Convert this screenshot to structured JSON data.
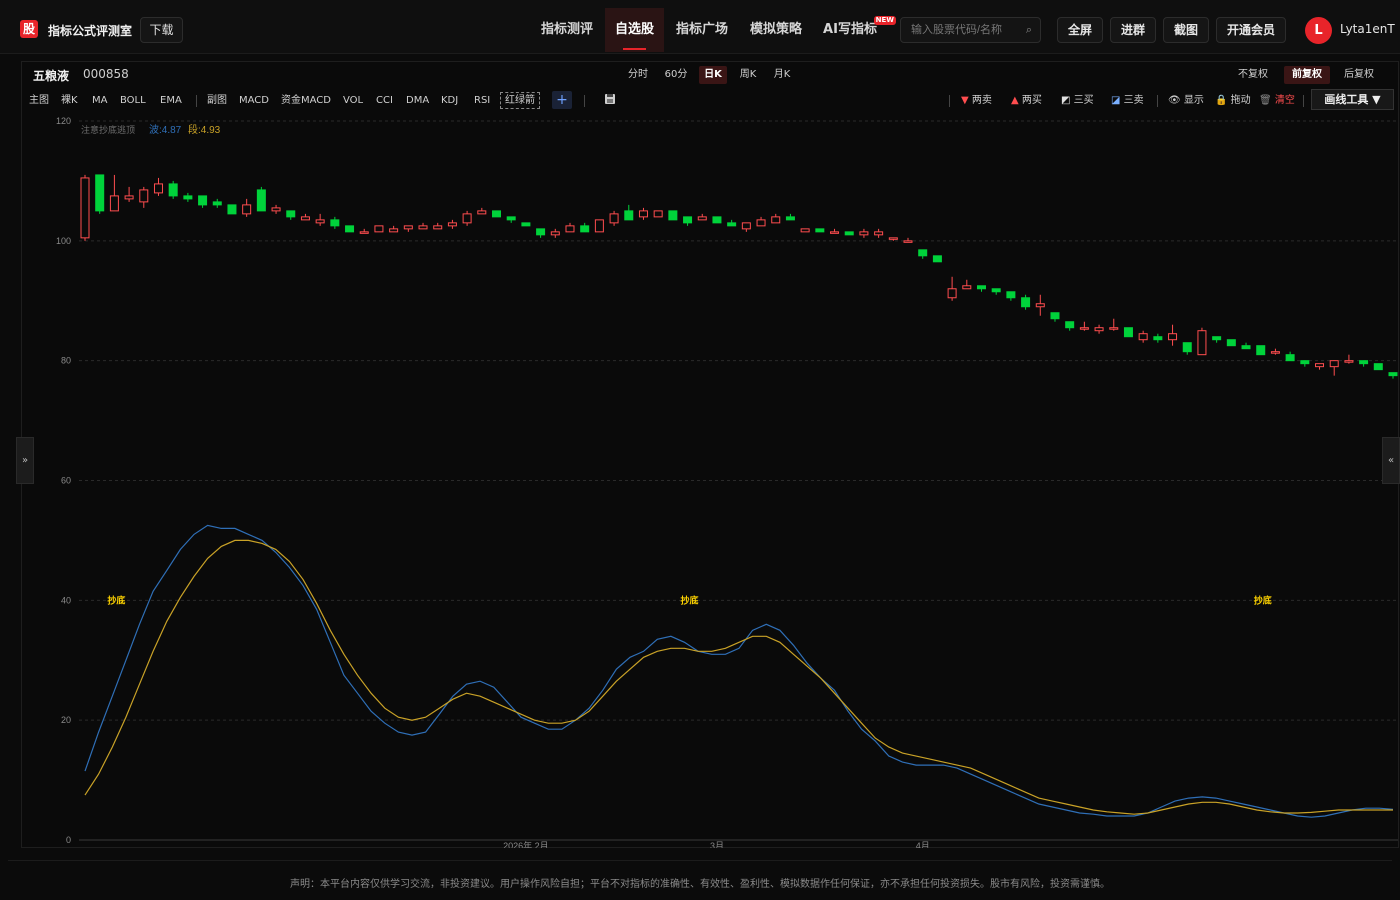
{
  "header": {
    "logo_char": "股",
    "logo_text": "指标公式评测室",
    "download_label": "下载",
    "nav": [
      "指标测评",
      "自选股",
      "指标广场",
      "模拟策略",
      "AI写指标"
    ],
    "new_badge": "NEW",
    "search_placeholder": "输入股票代码/名称",
    "fullscreen_label": "全屏",
    "join_group_label": "进群",
    "screenshot_label": "截图",
    "vip_label": "开通会员",
    "avatar_letter": "L",
    "username": "Lyta1enT"
  },
  "stock": {
    "name": "五粮液",
    "code": "000858"
  },
  "periods": [
    "分时",
    "60分",
    "日K",
    "周K",
    "月K"
  ],
  "active_period": "日K",
  "adjustments": [
    "不复权",
    "前复权",
    "后复权"
  ],
  "active_adjustment": "前复权",
  "indicators": {
    "main_group": [
      "主图",
      "裸K",
      "MA",
      "BOLL",
      "EMA"
    ],
    "sub_group": [
      "副图",
      "MACD",
      "资金MACD",
      "VOL",
      "CCI",
      "DMA",
      "KDJ",
      "RSI",
      "红绿箭"
    ],
    "plus_label": "+"
  },
  "draw_bar": {
    "two_sell": "两卖",
    "two_buy": "两买",
    "three_buy": "三买",
    "three_sell": "三卖",
    "show": "显示",
    "drag": "拖动",
    "clear": "清空",
    "tool_button": "画线工具 ▼"
  },
  "legend": {
    "label": "注意抄底逃顶",
    "wave_text": "波:4.87",
    "segment_text": "段:4.93"
  },
  "signals": {
    "label": "抄底"
  },
  "colors": {
    "up": "#ff4d4f",
    "down": "#00d33b",
    "wave": "#2f6fb7",
    "segment": "#c9a227",
    "signal": "#ffd400",
    "accent": "#e8242a"
  },
  "chart_data": {
    "type": "candlestick+line",
    "y_axis": {
      "range": [
        0,
        120
      ],
      "ticks": [
        0,
        20,
        40,
        60,
        80,
        100,
        120
      ]
    },
    "x_labels": [
      "2026年 2月",
      "3月",
      "4月"
    ],
    "candles": [
      {
        "o": 100.5,
        "c": 110.5,
        "h": 111,
        "l": 100
      },
      {
        "o": 111,
        "c": 105,
        "h": 111,
        "l": 104.5
      },
      {
        "o": 105,
        "c": 107.5,
        "h": 111,
        "l": 105
      },
      {
        "o": 107,
        "c": 107.5,
        "h": 109,
        "l": 106.5
      },
      {
        "o": 106.5,
        "c": 108.5,
        "h": 109,
        "l": 105.5
      },
      {
        "o": 108,
        "c": 109.5,
        "h": 110.5,
        "l": 107.5
      },
      {
        "o": 109.5,
        "c": 107.5,
        "h": 110,
        "l": 107
      },
      {
        "o": 107.5,
        "c": 107,
        "h": 108,
        "l": 106.5
      },
      {
        "o": 107.5,
        "c": 106,
        "h": 107.5,
        "l": 105.5
      },
      {
        "o": 106.5,
        "c": 106,
        "h": 107,
        "l": 105.5
      },
      {
        "o": 106,
        "c": 104.5,
        "h": 106,
        "l": 104.5
      },
      {
        "o": 104.5,
        "c": 106,
        "h": 107,
        "l": 104
      },
      {
        "o": 108.5,
        "c": 105,
        "h": 109,
        "l": 105
      },
      {
        "o": 105,
        "c": 105.5,
        "h": 106,
        "l": 104.5
      },
      {
        "o": 105,
        "c": 104,
        "h": 105,
        "l": 103.5
      },
      {
        "o": 103.5,
        "c": 104,
        "h": 104.5,
        "l": 103.5
      },
      {
        "o": 103,
        "c": 103.5,
        "h": 104.5,
        "l": 102.5
      },
      {
        "o": 103.5,
        "c": 102.5,
        "h": 104,
        "l": 102
      },
      {
        "o": 102.5,
        "c": 101.5,
        "h": 102.5,
        "l": 101.5
      },
      {
        "o": 101.5,
        "c": 101.5,
        "h": 102,
        "l": 101.5
      },
      {
        "o": 101.5,
        "c": 102.5,
        "h": 102.5,
        "l": 101.5
      },
      {
        "o": 101.5,
        "c": 102,
        "h": 102.5,
        "l": 101.5
      },
      {
        "o": 102,
        "c": 102.5,
        "h": 102.5,
        "l": 101.5
      },
      {
        "o": 102,
        "c": 102.5,
        "h": 103,
        "l": 102
      },
      {
        "o": 102,
        "c": 102.5,
        "h": 103,
        "l": 102
      },
      {
        "o": 102.5,
        "c": 103,
        "h": 103.5,
        "l": 102
      },
      {
        "o": 103,
        "c": 104.5,
        "h": 105,
        "l": 102.5
      },
      {
        "o": 104.5,
        "c": 105,
        "h": 105.5,
        "l": 104.5
      },
      {
        "o": 105,
        "c": 104,
        "h": 105,
        "l": 104
      },
      {
        "o": 104,
        "c": 103.5,
        "h": 104,
        "l": 103
      },
      {
        "o": 103,
        "c": 102.5,
        "h": 103,
        "l": 102.5
      },
      {
        "o": 102,
        "c": 101,
        "h": 102,
        "l": 100.5
      },
      {
        "o": 101,
        "c": 101.5,
        "h": 102,
        "l": 100.5
      },
      {
        "o": 101.5,
        "c": 102.5,
        "h": 103,
        "l": 101.5
      },
      {
        "o": 102.5,
        "c": 101.5,
        "h": 103,
        "l": 101.5
      },
      {
        "o": 101.5,
        "c": 103.5,
        "h": 103.5,
        "l": 101.5
      },
      {
        "o": 103,
        "c": 104.5,
        "h": 105,
        "l": 102.5
      },
      {
        "o": 105,
        "c": 103.5,
        "h": 106,
        "l": 103.5
      },
      {
        "o": 104,
        "c": 105,
        "h": 105.5,
        "l": 103.5
      },
      {
        "o": 104,
        "c": 105,
        "h": 105,
        "l": 104
      },
      {
        "o": 105,
        "c": 103.5,
        "h": 105,
        "l": 103.5
      },
      {
        "o": 104,
        "c": 103,
        "h": 104,
        "l": 102.5
      },
      {
        "o": 103.5,
        "c": 104,
        "h": 104.5,
        "l": 103.5
      },
      {
        "o": 104,
        "c": 103,
        "h": 104,
        "l": 103
      },
      {
        "o": 103,
        "c": 102.5,
        "h": 103.5,
        "l": 102.5
      },
      {
        "o": 102,
        "c": 103,
        "h": 103,
        "l": 101.5
      },
      {
        "o": 102.5,
        "c": 103.5,
        "h": 104,
        "l": 102.5
      },
      {
        "o": 103,
        "c": 104,
        "h": 104.5,
        "l": 103
      },
      {
        "o": 104,
        "c": 103.5,
        "h": 104.5,
        "l": 103.5
      },
      {
        "o": 101.5,
        "c": 102,
        "h": 102,
        "l": 101.5
      },
      {
        "o": 102,
        "c": 101.5,
        "h": 102,
        "l": 101.5
      },
      {
        "o": 101.5,
        "c": 101.5,
        "h": 102,
        "l": 101.5
      },
      {
        "o": 101.5,
        "c": 101,
        "h": 101.5,
        "l": 101
      },
      {
        "o": 101,
        "c": 101.5,
        "h": 102,
        "l": 100.5
      },
      {
        "o": 101,
        "c": 101.5,
        "h": 102,
        "l": 100.5
      },
      {
        "o": 100.5,
        "c": 100.5,
        "h": 100.5,
        "l": 100
      },
      {
        "o": 100,
        "c": 100,
        "h": 100.5,
        "l": 100
      },
      {
        "o": 98.5,
        "c": 97.5,
        "h": 98.5,
        "l": 97
      },
      {
        "o": 97.5,
        "c": 96.5,
        "h": 97.5,
        "l": 96.5
      },
      {
        "o": 90.5,
        "c": 92,
        "h": 94,
        "l": 90
      },
      {
        "o": 92,
        "c": 92.5,
        "h": 93.5,
        "l": 92
      },
      {
        "o": 92.5,
        "c": 92,
        "h": 92.5,
        "l": 91.5
      },
      {
        "o": 92,
        "c": 91.5,
        "h": 92,
        "l": 91
      },
      {
        "o": 91.5,
        "c": 90.5,
        "h": 91.5,
        "l": 90
      },
      {
        "o": 90.5,
        "c": 89,
        "h": 91,
        "l": 88.5
      },
      {
        "o": 89,
        "c": 89.5,
        "h": 91,
        "l": 87.5
      },
      {
        "o": 88,
        "c": 87,
        "h": 88,
        "l": 86.5
      },
      {
        "o": 86.5,
        "c": 85.5,
        "h": 86.5,
        "l": 85
      },
      {
        "o": 85.5,
        "c": 85.5,
        "h": 86.5,
        "l": 85
      },
      {
        "o": 85,
        "c": 85.5,
        "h": 86,
        "l": 84.5
      },
      {
        "o": 85.5,
        "c": 85.5,
        "h": 87,
        "l": 85
      },
      {
        "o": 85.5,
        "c": 84,
        "h": 85.5,
        "l": 84
      },
      {
        "o": 83.5,
        "c": 84.5,
        "h": 85,
        "l": 83
      },
      {
        "o": 84,
        "c": 83.5,
        "h": 84.5,
        "l": 83
      },
      {
        "o": 83.5,
        "c": 84.5,
        "h": 86,
        "l": 82.5
      },
      {
        "o": 83,
        "c": 81.5,
        "h": 83,
        "l": 81
      },
      {
        "o": 81,
        "c": 85,
        "h": 85.5,
        "l": 81
      },
      {
        "o": 84,
        "c": 83.5,
        "h": 84,
        "l": 83
      },
      {
        "o": 83.5,
        "c": 82.5,
        "h": 83.5,
        "l": 82.5
      },
      {
        "o": 82.5,
        "c": 82,
        "h": 83,
        "l": 82
      },
      {
        "o": 82.5,
        "c": 81,
        "h": 82.5,
        "l": 81
      },
      {
        "o": 81.5,
        "c": 81.5,
        "h": 82,
        "l": 81
      },
      {
        "o": 81,
        "c": 80,
        "h": 81.5,
        "l": 80
      },
      {
        "o": 80,
        "c": 79.5,
        "h": 80,
        "l": 79
      },
      {
        "o": 79,
        "c": 79.5,
        "h": 79.5,
        "l": 78.5
      },
      {
        "o": 79,
        "c": 80,
        "h": 80,
        "l": 77.5
      },
      {
        "o": 80,
        "c": 80,
        "h": 81,
        "l": 79.5
      },
      {
        "o": 80,
        "c": 79.5,
        "h": 80,
        "l": 79
      },
      {
        "o": 79.5,
        "c": 78.5,
        "h": 79.5,
        "l": 78.5
      },
      {
        "o": 78,
        "c": 77.5,
        "h": 78,
        "l": 77
      }
    ],
    "series": [
      {
        "key": "wave",
        "values": [
          11.5,
          18,
          24,
          30,
          36,
          41.5,
          45,
          48.5,
          51,
          52.5,
          52,
          52,
          51,
          50,
          48,
          45.5,
          42.5,
          38.5,
          33,
          27.5,
          24.5,
          21.5,
          19.5,
          18,
          17.5,
          18,
          21,
          24,
          26,
          26.5,
          25.5,
          23,
          20.5,
          19.5,
          18.5,
          18.5,
          20,
          22,
          25,
          28.5,
          30.5,
          31.5,
          33.5,
          34,
          33,
          31.5,
          31,
          31,
          32,
          35,
          36,
          35,
          32.5,
          29.5,
          27,
          25,
          21.5,
          18.5,
          16.5,
          14,
          13,
          12.5,
          12.5,
          12.5,
          12,
          11,
          10,
          9,
          8,
          7,
          6,
          5.5,
          5,
          4.5,
          4.3,
          4,
          4,
          4,
          4.5,
          5.5,
          6.5,
          7,
          7.2,
          7,
          6.5,
          6,
          5.5,
          5,
          4.5,
          4,
          3.8,
          4,
          4.5,
          5,
          5.3,
          5.3,
          5.1
        ]
      },
      {
        "key": "segment",
        "values": [
          7.5,
          11,
          15.5,
          20.5,
          26,
          31.5,
          36.5,
          40.5,
          44,
          47,
          49,
          50,
          50,
          49.5,
          48.5,
          46.5,
          43.5,
          39.5,
          35,
          31,
          27.5,
          24.5,
          22,
          20.5,
          20,
          20.5,
          22,
          23.5,
          24.5,
          24,
          23,
          22,
          21,
          20,
          19.5,
          19.5,
          20,
          21.5,
          24,
          26.5,
          28.5,
          30.5,
          31.5,
          32,
          32,
          31.5,
          31.5,
          32,
          33,
          34,
          34,
          33,
          31,
          29,
          27,
          24.5,
          22,
          19.5,
          17,
          15.5,
          14.5,
          14,
          13.5,
          13,
          12.5,
          12,
          11,
          10,
          9,
          8,
          7,
          6.5,
          6,
          5.5,
          5,
          4.7,
          4.5,
          4.3,
          4.5,
          5,
          5.5,
          6,
          6.3,
          6.3,
          6,
          5.5,
          5,
          4.7,
          4.5,
          4.5,
          4.6,
          4.8,
          5,
          5,
          5,
          5,
          5
        ]
      }
    ],
    "signal_levels": [
      40
    ],
    "signal_positions": [
      "2",
      "41",
      "80"
    ]
  },
  "footer_text": "声明：本平台内容仅供学习交流，非投资建议。用户操作风险自担；平台不对指标的准确性、有效性、盈利性、模拟数据作任何保证，亦不承担任何投资损失。股市有风险，投资需谨慎。"
}
